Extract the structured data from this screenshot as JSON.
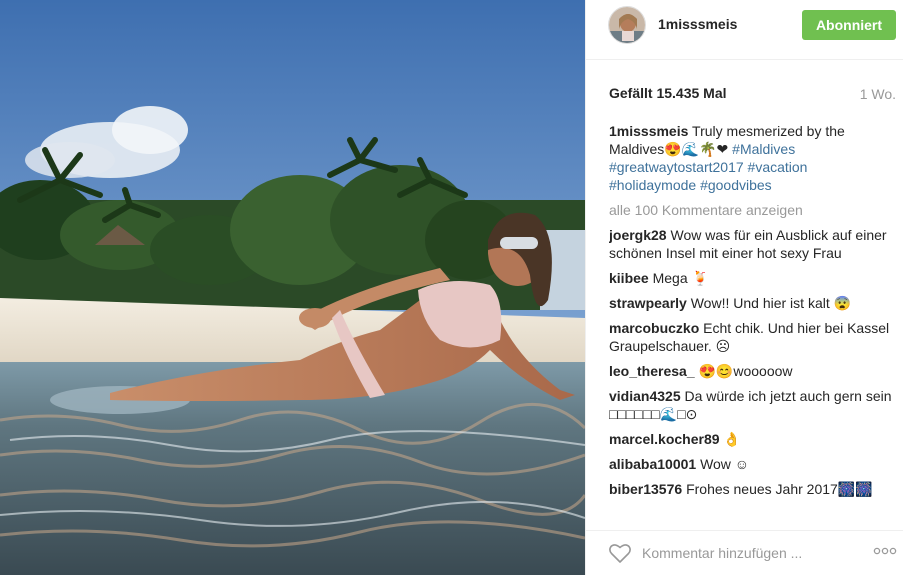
{
  "post": {
    "username": "1misssmeis",
    "follow_label": "Abonniert",
    "likes": "Gefällt 15.435 Mal",
    "age": "1 Wo.",
    "caption": {
      "user": "1misssmeis",
      "text": "Truly mesmerized by the Maldives😍🌊🌴❤",
      "tags": [
        "#Maldives",
        "#greatwaytostart2017",
        "#vacation",
        "#holidaymode",
        "#goodvibes"
      ]
    },
    "more_comments": "alle 100 Kommentare anzeigen",
    "comments": [
      {
        "user": "joergk28",
        "text": "Wow was für ein Ausblick auf einer schönen Insel mit einer hot sexy Frau"
      },
      {
        "user": "kiibee",
        "text": "Mega 🍹"
      },
      {
        "user": "strawpearly",
        "text": "Wow!! Und hier ist kalt 😨"
      },
      {
        "user": "marcobuczko",
        "text": "Echt chik. Und hier bei Kassel Graupelschauer. ☹"
      },
      {
        "user": "leo_theresa_",
        "text": "😍😊wooooow"
      },
      {
        "user": "vidian4325",
        "text": "Da würde ich jetzt auch gern sein □□□□□□🌊□⊙"
      },
      {
        "user": "marcel.kocher89",
        "text": "👌"
      },
      {
        "user": "alibaba10001",
        "text": "Wow ☺"
      },
      {
        "user": "biber13576",
        "text": "Frohes neues Jahr 2017🎆🎆"
      }
    ],
    "comment_placeholder": "Kommentar hinzufügen ...",
    "colors": {
      "follow": "#70c050",
      "hashtag": "#3f729b",
      "muted": "#999999"
    }
  }
}
